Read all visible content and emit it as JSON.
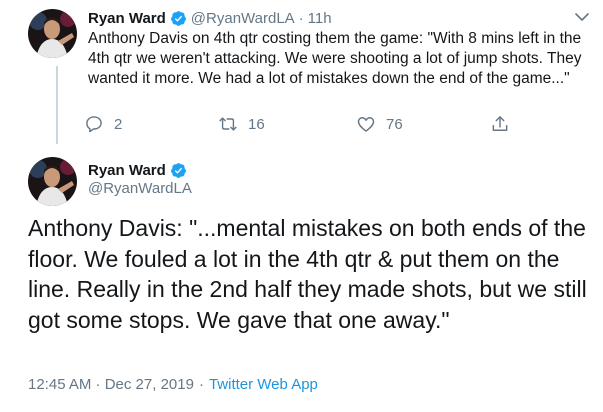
{
  "colors": {
    "text": "#14171a",
    "muted": "#657786",
    "link": "#1b95e0",
    "verified": "#1da1f2",
    "thread_line": "#ccd6dd"
  },
  "tweet1": {
    "name": "Ryan Ward",
    "handle": "@RyanWardLA",
    "separator": "·",
    "time": "11h",
    "text": "Anthony Davis on 4th qtr costing them the game: \"With 8 mins left in the 4th qtr we weren't attacking. We were shooting a lot of jump shots. They wanted it more. We had a lot of mistakes down the end of the game...\"",
    "replies": "2",
    "retweets": "16",
    "likes": "76",
    "icons": [
      "reply-icon",
      "retweet-icon",
      "like-icon",
      "share-icon",
      "chevron-down-icon",
      "verified-icon"
    ]
  },
  "tweet2": {
    "name": "Ryan Ward",
    "handle": "@RyanWardLA",
    "text": "Anthony Davis: \"...mental mistakes on both ends of the floor. We fouled a lot in the 4th qtr & put them on the line. Really in the 2nd half they made shots, but we still got some stops. We gave that one away.\"",
    "timestamp": "12:45 AM · Dec 27, 2019",
    "separator": "·",
    "source": "Twitter Web App"
  }
}
